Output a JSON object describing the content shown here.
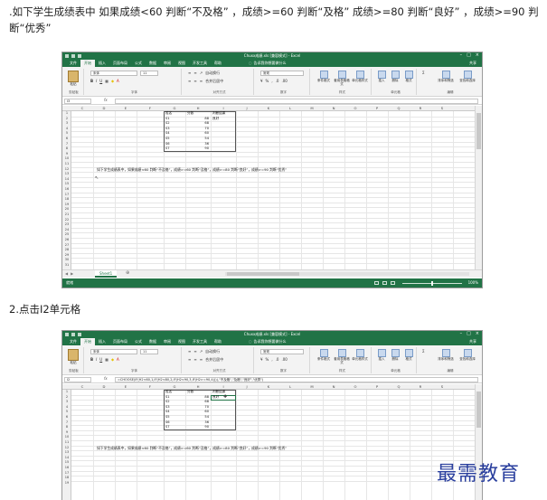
{
  "steps": {
    "step1_text": ".如下学生成绩表中 如果成绩<60 判断“不及格” ，成绩>=60 判断“及格” 成绩>=80 判断“良好” ，成绩>=90 判断“优秀”",
    "step2_text": "2.点击I2单元格"
  },
  "excel": {
    "window_title": "Chuxx成绩.xls [兼容模式] - Excel",
    "tabs": [
      "文件",
      "开始",
      "插入",
      "页面布局",
      "公式",
      "数据",
      "审阅",
      "视图",
      "开发工具",
      "帮助"
    ],
    "active_tab": "开始",
    "tell_me": "告诉我你想要做什么",
    "share": "共享",
    "ribbon": {
      "paste": "粘贴",
      "clipboard": "剪贴板",
      "font_name": "宋体",
      "font_size": "11",
      "font_group": "字体",
      "wrap_text": "自动换行",
      "merge_center": "合并后居中",
      "alignment_group": "对齐方式",
      "number_format": "常规",
      "number_group": "数字",
      "conditional_format": "条件格式",
      "format_as_table": "套用表格格式",
      "cell_styles": "单元格样式",
      "styles_group": "样式",
      "insert": "插入",
      "delete": "删除",
      "format": "格式",
      "cells_group": "单元格",
      "sort_filter": "排序和筛选",
      "find_select": "查找和选择",
      "editing_group": "编辑"
    },
    "formula_bar": {
      "name_box_1": "I3",
      "formula_1": "",
      "name_box_2": "I2",
      "formula_2": "=CHOOSE(IF(H2<60,1,IF(H2<80,2,IF(H2<90,3,IF(H2>=90,4)))),\"不及格\",\"及格\",\"良好\",\"优秀\")"
    },
    "columns": [
      "C",
      "D",
      "E",
      "F",
      "G",
      "H",
      "I",
      "J",
      "K",
      "L",
      "M",
      "N",
      "O",
      "P",
      "Q",
      "R",
      "S"
    ],
    "rows_1": [
      "1",
      "2",
      "3",
      "4",
      "5",
      "6",
      "7",
      "8",
      "9",
      "10",
      "11",
      "12",
      "13",
      "14",
      "15",
      "16",
      "17",
      "18",
      "19",
      "20",
      "21",
      "22",
      "23",
      "24",
      "25",
      "26",
      "27",
      "28",
      "29",
      "30",
      "31"
    ],
    "rows_2": [
      "1",
      "2",
      "3",
      "4",
      "5",
      "6",
      "7",
      "8",
      "9",
      "10",
      "11",
      "12",
      "13",
      "14",
      "15",
      "16",
      "17",
      "18",
      "19"
    ],
    "table": {
      "headers": [
        "姓名",
        "分数",
        "判断结果"
      ],
      "names": [
        "S1",
        "S2",
        "S3",
        "S4",
        "S5",
        "S6",
        "S7"
      ],
      "scores": [
        "88",
        "68",
        "70",
        "60",
        "54",
        "36",
        "90"
      ],
      "result_row1_shot1": "良好",
      "result_row1_shot2": "良好"
    },
    "note": "如下学生成绩表中，如果成绩<60 判断“不及格”，成绩>=60 判断“及格”，成绩>=80 判断“良好”，成绩>=90 判断“优秀”",
    "sheet_tab": "Sheet1",
    "status_ready": "就绪",
    "zoom": "100%"
  },
  "watermark": "最需教育"
}
